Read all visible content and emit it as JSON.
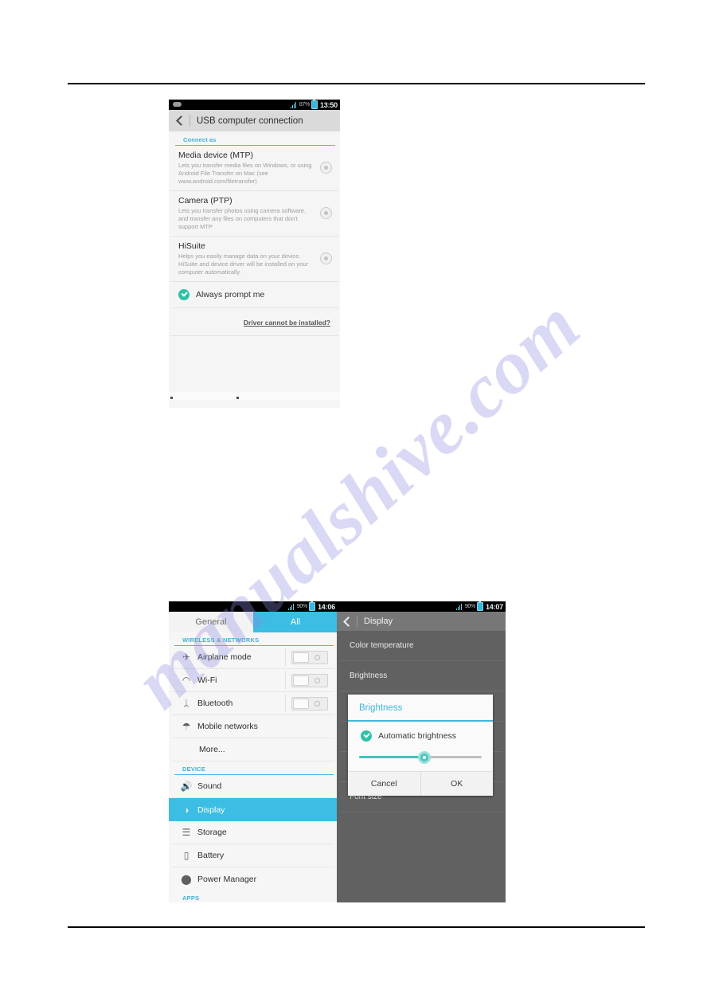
{
  "watermark": {
    "text": "manualshive.com"
  },
  "usb_screen": {
    "statusbar": {
      "battery_percent": "87%",
      "time": "13:50"
    },
    "title": "USB computer connection",
    "section_header": "Connect as",
    "options": [
      {
        "title": "Media device (MTP)",
        "description": "Lets you transfer media files on Windows, or using Android File Transfer on Mac (see www.android.com/filetransfer)"
      },
      {
        "title": "Camera (PTP)",
        "description": "Lets you transfer photos using camera software, and transfer any files on computers that don't support MTP"
      },
      {
        "title": "HiSuite",
        "description": "Helps you easily manage data on your device. HiSuite and device driver will be installed on your computer automatically."
      }
    ],
    "always_prompt_label": "Always prompt me",
    "driver_link": "Driver cannot be installed?"
  },
  "settings_screen": {
    "statusbar": {
      "battery_percent": "90%",
      "time": "14:06"
    },
    "tabs": [
      {
        "label": "General",
        "active": false
      },
      {
        "label": "All",
        "active": true
      }
    ],
    "groups": [
      {
        "header": "WIRELESS & NETWORKS",
        "items": [
          {
            "label": "Airplane mode",
            "icon": "airplane-icon",
            "glyph": "✈",
            "toggle": true
          },
          {
            "label": "Wi-Fi",
            "icon": "wifi-icon",
            "glyph": "◠",
            "toggle": true
          },
          {
            "label": "Bluetooth",
            "icon": "bluetooth-icon",
            "glyph": "ᛦ",
            "toggle": true
          },
          {
            "label": "Mobile networks",
            "icon": "cell-tower-icon",
            "glyph": "☂",
            "toggle": false
          },
          {
            "label": "More...",
            "icon": "",
            "glyph": "",
            "toggle": false
          }
        ]
      },
      {
        "header": "DEVICE",
        "items": [
          {
            "label": "Sound",
            "icon": "speaker-icon",
            "glyph": "🔊",
            "toggle": false
          },
          {
            "label": "Display",
            "icon": "brightness-icon",
            "glyph": "◑",
            "toggle": false,
            "selected": true
          },
          {
            "label": "Storage",
            "icon": "storage-icon",
            "glyph": "☰",
            "toggle": false
          },
          {
            "label": "Battery",
            "icon": "battery-icon",
            "glyph": "▯",
            "toggle": false
          },
          {
            "label": "Power Manager",
            "icon": "location-pin-icon",
            "glyph": "⬤",
            "toggle": false
          }
        ]
      },
      {
        "header": "APPS",
        "items": []
      }
    ]
  },
  "display_screen": {
    "statusbar": {
      "battery_percent": "90%",
      "time": "14:07"
    },
    "title": "Display",
    "rows": [
      {
        "label": "Color temperature"
      },
      {
        "label": "Brightness"
      },
      {
        "label": "Font size"
      }
    ],
    "dialog": {
      "title": "Brightness",
      "auto_label": "Automatic brightness",
      "slider_percent": 53,
      "cancel_label": "Cancel",
      "ok_label": "OK"
    }
  },
  "colors": {
    "accent_blue": "#3bbde4",
    "teal": "#3ec4bd",
    "green_check": "#2ec2a5",
    "dark_surface": "#616161"
  }
}
